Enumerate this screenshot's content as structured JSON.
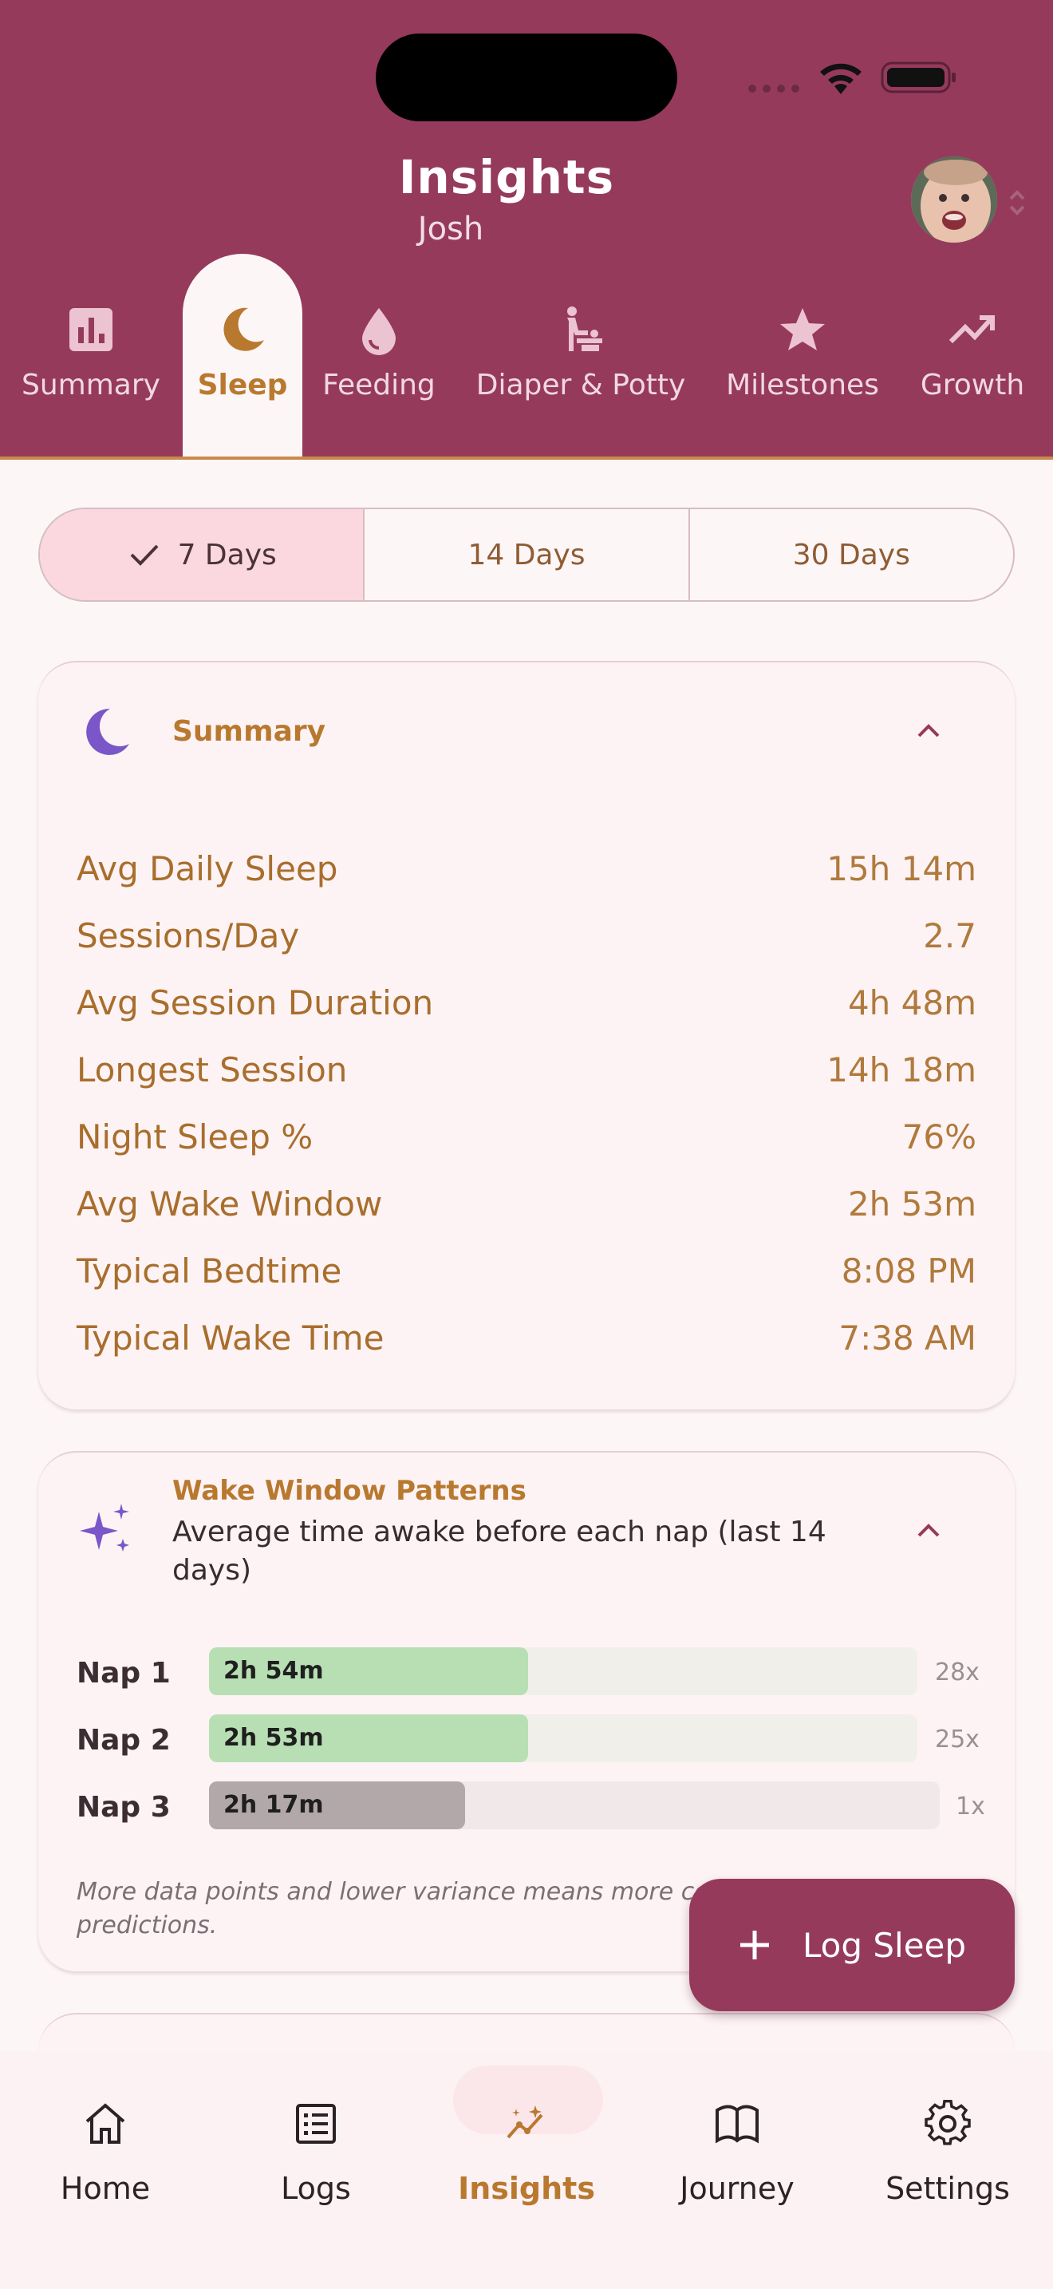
{
  "header": {
    "title": "Insights",
    "subtitle": "Josh"
  },
  "category_tabs": [
    {
      "label": "Summary",
      "icon": "bar-chart-icon"
    },
    {
      "label": "Sleep",
      "icon": "moon-icon",
      "active": true
    },
    {
      "label": "Feeding",
      "icon": "drop-icon"
    },
    {
      "label": "Diaper & Potty",
      "icon": "baby-changing-icon"
    },
    {
      "label": "Milestones",
      "icon": "star-icon"
    },
    {
      "label": "Growth",
      "icon": "trending-up-icon"
    }
  ],
  "range_selector": {
    "options": [
      "7 Days",
      "14 Days",
      "30 Days"
    ],
    "selected": "7 Days"
  },
  "summary_card": {
    "title": "Summary",
    "stats": [
      {
        "label": "Avg Daily Sleep",
        "value": "15h 14m"
      },
      {
        "label": "Sessions/Day",
        "value": "2.7"
      },
      {
        "label": "Avg Session Duration",
        "value": "4h 48m"
      },
      {
        "label": "Longest Session",
        "value": "14h 18m"
      },
      {
        "label": "Night Sleep %",
        "value": "76%"
      },
      {
        "label": "Avg Wake Window",
        "value": "2h 53m"
      },
      {
        "label": "Typical Bedtime",
        "value": "8:08 PM"
      },
      {
        "label": "Typical Wake Time",
        "value": "7:38 AM"
      }
    ]
  },
  "wake_card": {
    "title": "Wake Window Patterns",
    "subtitle": "Average time awake before each nap (last 14 days)",
    "naps": [
      {
        "label": "Nap 1",
        "value": "2h 54m",
        "count": "28x",
        "fraction": 0.45,
        "color": "#b7dfb3",
        "track": "#f1efe9"
      },
      {
        "label": "Nap 2",
        "value": "2h 53m",
        "count": "25x",
        "fraction": 0.45,
        "color": "#b7dfb3",
        "track": "#f1efe9"
      },
      {
        "label": "Nap 3",
        "value": "2h 17m",
        "count": "1x",
        "fraction": 0.35,
        "color": "#b3a8a9",
        "track": "#f0e8e9"
      }
    ],
    "footnote": "More data points and lower variance means more confident predictions."
  },
  "fab": {
    "label": "Log Sleep"
  },
  "bottom_nav": [
    {
      "label": "Home",
      "icon": "home-icon"
    },
    {
      "label": "Logs",
      "icon": "list-icon"
    },
    {
      "label": "Insights",
      "icon": "insights-icon",
      "active": true
    },
    {
      "label": "Journey",
      "icon": "book-icon"
    },
    {
      "label": "Settings",
      "icon": "gear-icon"
    }
  ],
  "colors": {
    "brand": "#963a5c",
    "accent": "#b8792f",
    "moon": "#7a56c8"
  }
}
